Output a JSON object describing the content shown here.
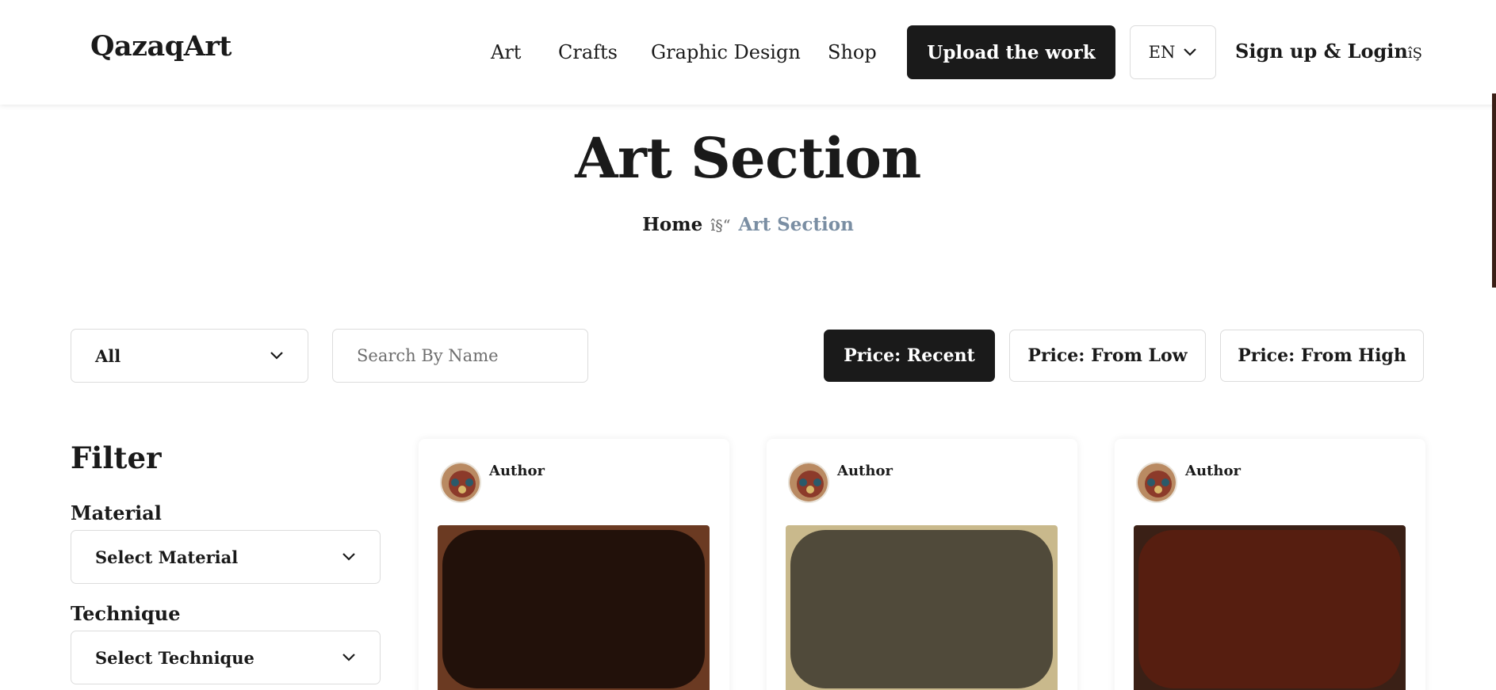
{
  "header": {
    "logo": "QazaqArt",
    "nav": [
      "Art",
      "Crafts",
      "Graphic Design",
      "Shop"
    ],
    "upload_label": "Upload the work",
    "language": "EN",
    "login_label": "Sign up & Login",
    "login_icon_text": "îŞ"
  },
  "hero": {
    "title": "Art Section",
    "breadcrumb_home": "Home",
    "breadcrumb_separator": "î§“",
    "breadcrumb_current": "Art Section"
  },
  "toolbar": {
    "category_selected": "All",
    "search_placeholder": "Search By Name",
    "sort_options": [
      "Price: Recent",
      "Price: From Low",
      "Price: From High"
    ],
    "sort_active": "Price: Recent"
  },
  "filter": {
    "title": "Filter",
    "material_label": "Material",
    "material_selected": "Select Material",
    "technique_label": "Technique",
    "technique_selected": "Select Technique"
  },
  "cards": [
    {
      "author": "Author",
      "frame_color": "#6b3a22",
      "art_color": "#22110a"
    },
    {
      "author": "Author",
      "frame_color": "#c9b98c",
      "art_color": "#504a3a"
    },
    {
      "author": "Author",
      "frame_color": "#3a2016",
      "art_color": "#561e10"
    }
  ],
  "colors": {
    "primary": "#1a1a1a",
    "breadcrumb_current": "#7a8ea3",
    "border": "#dcdcdc"
  }
}
